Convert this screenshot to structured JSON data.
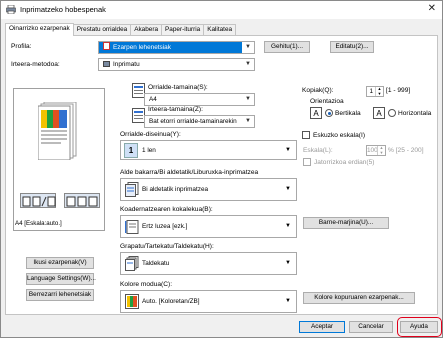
{
  "window": {
    "title": "Inprimatzeko hobespenak",
    "close": "✕"
  },
  "tabs": [
    "Oinarrizko ezarpenak",
    "Prestatu orrialdea",
    "Akabera",
    "Paper-iturria",
    "Kalitatea"
  ],
  "profile": {
    "label": "Profila:",
    "value": "Ezarpen lehenetsiak",
    "add": "Gehitu(1)...",
    "edit": "Editatu(2)..."
  },
  "output_method": {
    "label": "Irteera-metodoa:",
    "value": "Inprimatu"
  },
  "preview": {
    "caption": "A4 [Eskala:auto.]"
  },
  "original_size": {
    "label": "Orrialde-tamaina(S):",
    "value": "A4"
  },
  "output_size": {
    "label": "Irteera-tamaina(Z):",
    "value": "Bat etorri orrialde-tamainarekin"
  },
  "orientation_layout": {
    "label": "Orrialde-diseinua(Y):",
    "value": "1 len"
  },
  "duplex": {
    "label": "Alde bakarra/Bi aldetatik/Liburuxka-inprimatzea",
    "value": "Bi aldetatik inprimatzea"
  },
  "finishing": {
    "label": "Koadernatzearen kokalekua(B):",
    "value": "Ertz luzea [ezk.]"
  },
  "staple": {
    "label": "Grapatu/Tartekatu/Taldekatu(H):",
    "value": "Taldekatu"
  },
  "color_mode": {
    "label": "Kolore modua(C):",
    "value": "Auto. [Koloretan/ZB]"
  },
  "copies": {
    "label": "Kopiak(Q):",
    "value": "1",
    "range": "[1 - 999]"
  },
  "orientation": {
    "label": "Orientazioa",
    "portrait": "Bertikala",
    "landscape": "Horizontala",
    "portrait_glyph": "A",
    "landscape_glyph": "A"
  },
  "manual_scaling": {
    "label": "Eskuzko eskala(I)",
    "scale_label": "Eskala(L):",
    "scale_value": "100",
    "scale_range": "% [25 - 200]",
    "watermark": "Jatorrizkoa erdian(5)"
  },
  "buttons": {
    "margin": "Barne-marjina(U)...",
    "view_settings": "Ikusi ezarpenak(V)",
    "language": "Language Settings(W)...",
    "restore": "Berrezarri lehenetsiak",
    "color_adjust": "Kolore kopuruaren ezarpenak...",
    "ok": "Aceptar",
    "cancel": "Cancelar",
    "help": "Ayuda"
  },
  "colors": {
    "accent": "#0078d7",
    "highlight_ring": "#e0001b"
  }
}
